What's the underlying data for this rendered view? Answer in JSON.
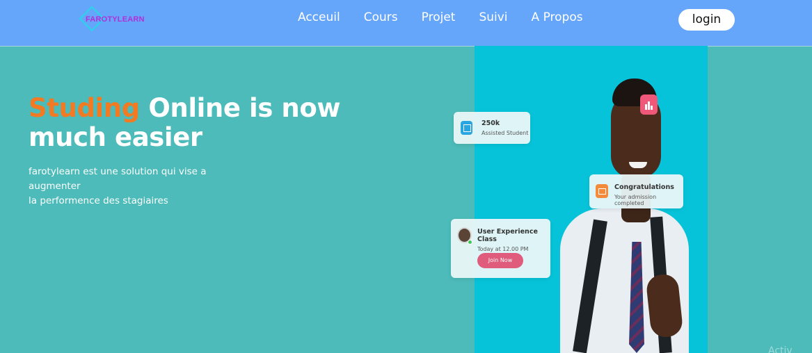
{
  "brand": {
    "name": "FAROTYLEARN"
  },
  "nav": {
    "links": [
      "Acceuil",
      "Cours",
      "Projet",
      "Suivi",
      "A Propos"
    ],
    "login_label": "login"
  },
  "hero": {
    "title_accent": "Studing",
    "title_rest_line1": " Online is now",
    "title_line2": "much easier",
    "description_line1": "farotylearn est une solution qui vise a augmenter",
    "description_line2": "la performence des stagiaires"
  },
  "cards": {
    "students": {
      "value": "250k",
      "label": "Assisted Student"
    },
    "congrats": {
      "title": "Congratulations",
      "subtitle": "Your admission completed"
    },
    "class": {
      "title": "User Experience Class",
      "time": "Today at 12.00 PM",
      "button": "Join Now"
    }
  },
  "watermark": "Activ",
  "colors": {
    "navbar": "#65a5fa",
    "background": "#4cbbb9",
    "accent": "#f27a23",
    "photo_panel": "#07c3d9",
    "join_button": "#e05c7c"
  }
}
